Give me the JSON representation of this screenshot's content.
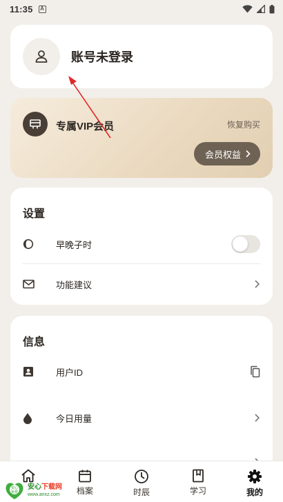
{
  "status_bar": {
    "time": "11:35",
    "notif_glyph": "A"
  },
  "account": {
    "name": "账号未登录"
  },
  "vip": {
    "title": "专属VIP会员",
    "restore": "恢复购买",
    "benefits_button": "会员权益"
  },
  "settings": {
    "title": "设置",
    "items": [
      {
        "label": "早晚子时",
        "icon": "half-moon-icon",
        "control": "toggle",
        "on": false
      },
      {
        "label": "功能建议",
        "icon": "mail-icon",
        "control": "chevron"
      }
    ]
  },
  "info": {
    "title": "信息",
    "items": [
      {
        "label": "用户ID",
        "icon": "contact-card-icon",
        "control": "copy"
      },
      {
        "label": "今日用量",
        "icon": "drop-icon",
        "control": "chevron"
      }
    ]
  },
  "nav": {
    "items": [
      {
        "label": "",
        "icon": "home-icon",
        "active": false
      },
      {
        "label": "档案",
        "icon": "calendar-icon",
        "active": false
      },
      {
        "label": "时辰",
        "icon": "clock-icon",
        "active": false
      },
      {
        "label": "学习",
        "icon": "book-icon",
        "active": false
      },
      {
        "label": "我的",
        "icon": "gear-icon",
        "active": true
      }
    ]
  },
  "watermark": {
    "main_a": "安心",
    "main_b": "下载网",
    "url": "www.anxz.com",
    "logo_text": "安心\n免费"
  },
  "colors": {
    "background": "#f2efea",
    "vip_button": "#6e6254",
    "vip_badge": "#4a3f36",
    "annotation_arrow": "#e0282a"
  }
}
